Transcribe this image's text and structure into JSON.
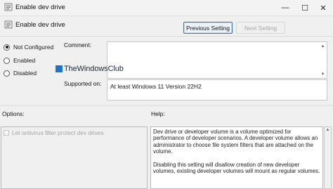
{
  "window": {
    "title": "Enable dev drive",
    "controls": {
      "minimize": "—",
      "maximize": "☐",
      "close": "✕"
    }
  },
  "header": {
    "setting_name": "Enable dev drive",
    "previous_label": "Previous Setting",
    "next_label": "Next Setting"
  },
  "state": {
    "options": [
      {
        "label": "Not Configured",
        "selected": true
      },
      {
        "label": "Enabled",
        "selected": false
      },
      {
        "label": "Disabled",
        "selected": false
      }
    ]
  },
  "comment": {
    "label": "Comment:",
    "value": ""
  },
  "supported": {
    "label": "Supported on:",
    "value": "At least Windows 11 Version 22H2"
  },
  "watermark": {
    "text": "TheWindowsClub"
  },
  "options_pane": {
    "label": "Options:",
    "checkbox_label": "Let antivirus filter protect dev drives",
    "checkbox_checked": false,
    "checkbox_enabled": false
  },
  "help_pane": {
    "label": "Help:",
    "paragraphs": [
      "Dev drive or developer volume is a volume optimized for performance of developer scenarios. A developer volume allows an administrator to choose file system filters that are attached on the volume.",
      "Disabling this setting will disallow creation of new developer volumes, existing developer volumes will mount as regular volumes."
    ]
  },
  "colors": {
    "accent": "#3c6fb8",
    "watermark_blue": "#1f73c6"
  },
  "icons": [
    "policy-settings-icon",
    "minimize-icon",
    "maximize-icon",
    "close-icon",
    "scroll-up-icon",
    "scroll-down-icon"
  ]
}
